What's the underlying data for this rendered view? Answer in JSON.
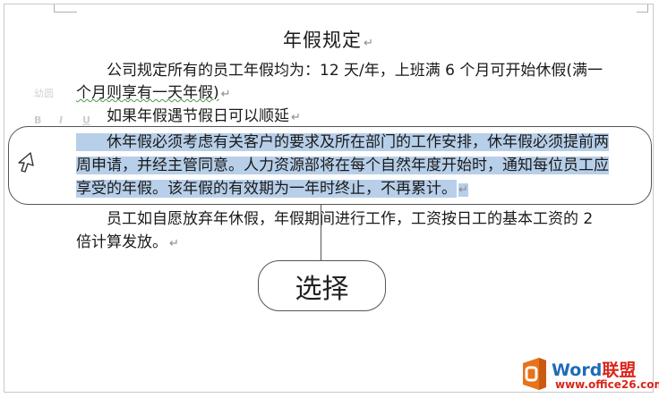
{
  "document": {
    "title": "年假规定",
    "paragraph_mark": "↵",
    "para1": {
      "line1": "公司规定所有的员工年假均为：12 天/年，上班满 6 个月可开始休假(满一",
      "line2": "个月则享有一天年假)"
    },
    "para2": {
      "line1": "如果年假遇节假日可以顺延"
    },
    "para3_selected": {
      "line1": "休年假必须考虑有关客户的要求及所在部门的工作安排，休年假必须提前两",
      "line2": "周申请，并经主管同意。人力资源部将在每个自然年度开始时，通知每位员工应",
      "line3": "享受的年假。该年假的有效期为一年时终止，不再累计。"
    },
    "para4": {
      "line1": "员工如自愿放弃年休假，年假期间进行工作，工资按日工的基本工资的 2",
      "line2": "倍计算发放。"
    }
  },
  "mini_toolbar": {
    "font_name": "幼圆",
    "bold": "B",
    "italic": "I",
    "underline": "U"
  },
  "callout": {
    "label": "选择"
  },
  "logo": {
    "word": "Word",
    "cn": "联盟",
    "url": "www.office26.com"
  },
  "colors": {
    "selection": "#b7cfe9",
    "logo_orange": "#e8731a",
    "logo_blue": "#1e6bb8",
    "logo_red": "#d9261c"
  },
  "icons": {
    "cursor": "cursor-arrow-icon",
    "office_logo": "office-logo-icon"
  }
}
